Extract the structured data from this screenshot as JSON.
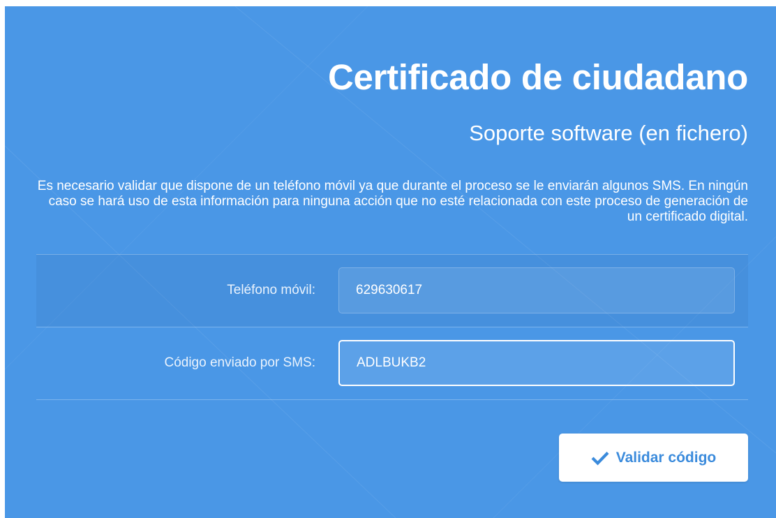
{
  "header": {
    "title": "Certificado de ciudadano",
    "subtitle": "Soporte software (en fichero)"
  },
  "description": "Es necesario validar que dispone de un teléfono móvil ya que durante el proceso se le enviarán algunos SMS. En ningún caso se hará uso de esta información para ninguna acción que no esté relacionada con este proceso de generación de un certificado digital.",
  "form": {
    "phone": {
      "label": "Teléfono móvil:",
      "value": "629630617"
    },
    "sms_code": {
      "label": "Código enviado por SMS:",
      "value": "ADLBUKB2"
    }
  },
  "actions": {
    "validate_label": "Validar código",
    "validate_icon": "check-icon"
  },
  "colors": {
    "background": "#4a97e6",
    "button_text": "#3b8bdc",
    "text": "#ffffff"
  }
}
